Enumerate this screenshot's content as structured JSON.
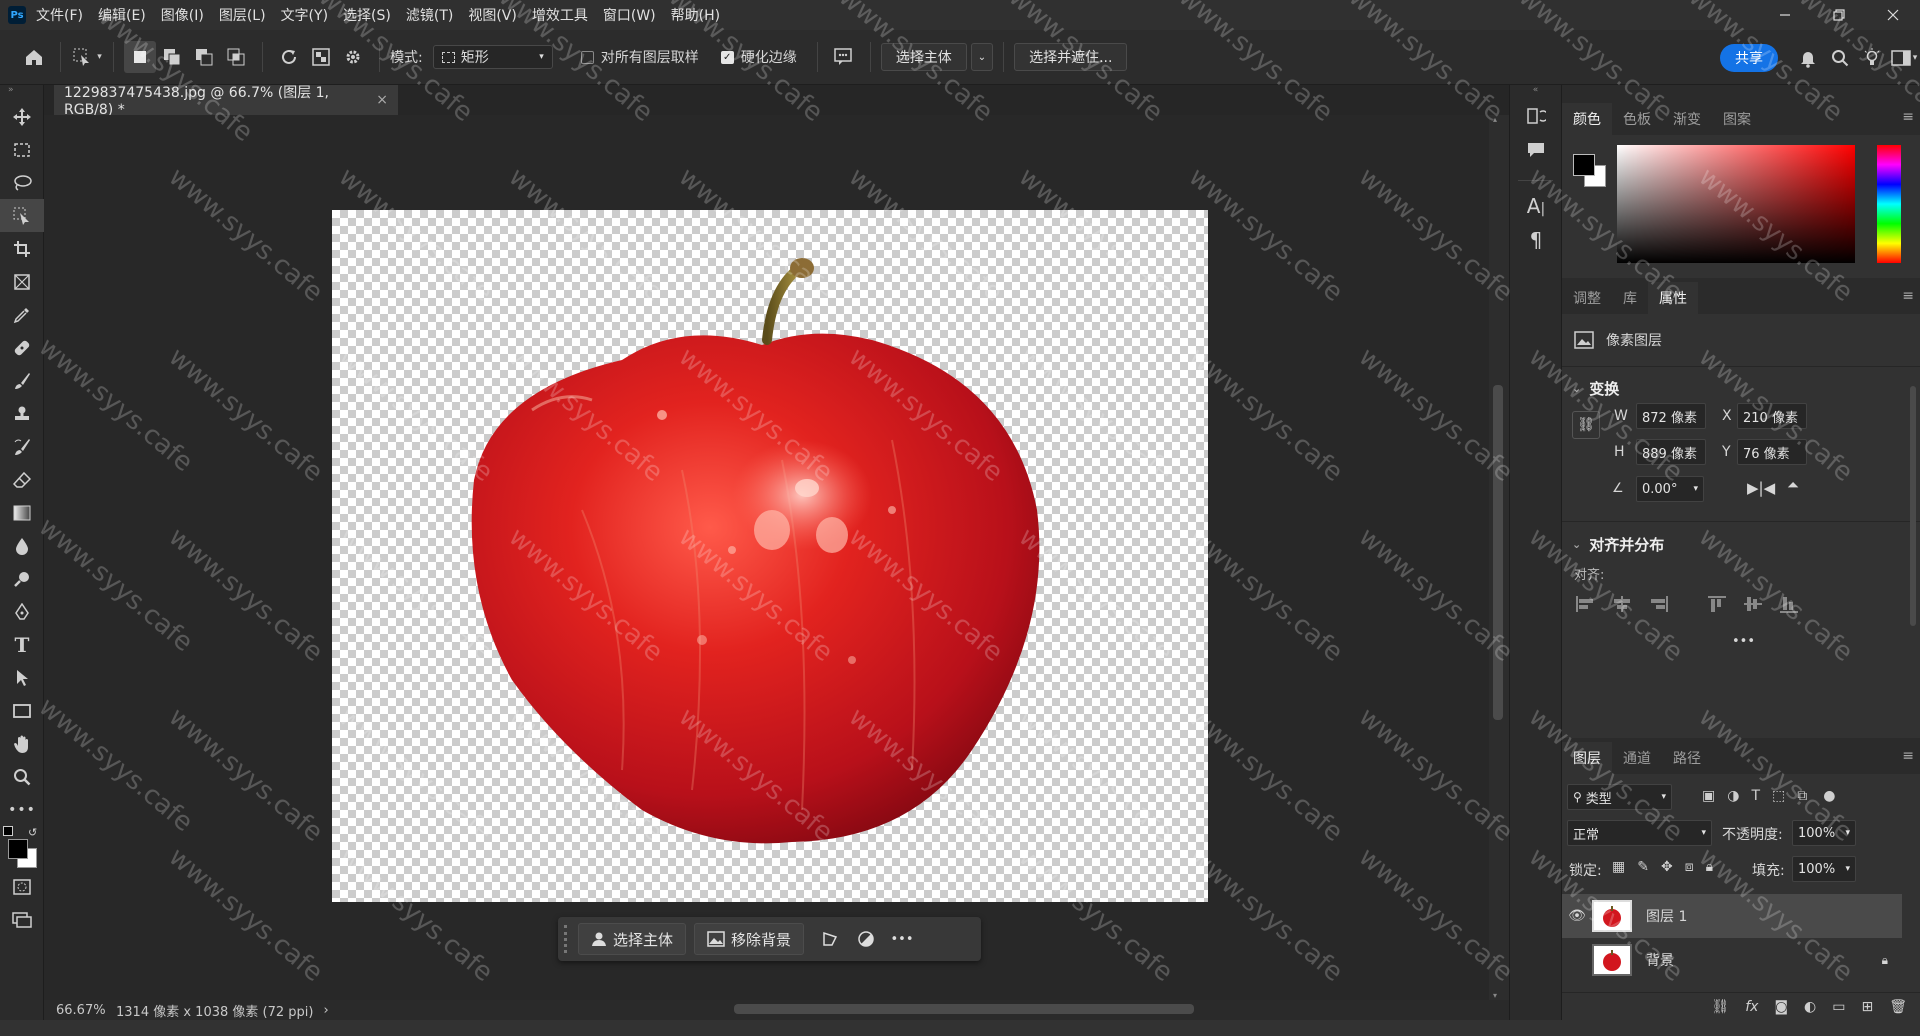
{
  "menubar": {
    "logo": "Ps",
    "items": [
      "文件(F)",
      "编辑(E)",
      "图像(I)",
      "图层(L)",
      "文字(Y)",
      "选择(S)",
      "滤镜(T)",
      "视图(V)",
      "增效工具",
      "窗口(W)",
      "帮助(H)"
    ]
  },
  "options": {
    "mode_label": "模式:",
    "mode_value": "矩形",
    "sample_all_label": "对所有图层取样",
    "sample_all_checked": false,
    "hard_edge_label": "硬化边缘",
    "hard_edge_checked": true,
    "select_subject": "选择主体",
    "select_mask": "选择并遮住...",
    "share": "共享"
  },
  "document": {
    "tab_title": "1229837475438.jpg @ 66.7% (图层 1, RGB/8) *",
    "close": "×"
  },
  "context_bar": {
    "select_subject": "选择主体",
    "remove_bg": "移除背景",
    "more": "•••"
  },
  "status": {
    "zoom": "66.67%",
    "info": "1314 像素 x 1038 像素 (72 ppi)",
    "arrow": "›"
  },
  "color_panel": {
    "tabs": [
      "颜色",
      "色板",
      "渐变",
      "图案"
    ],
    "active": "颜色"
  },
  "properties_panel": {
    "tabs": [
      "调整",
      "库",
      "属性"
    ],
    "active": "属性",
    "layer_type": "像素图层",
    "transform_title": "变换",
    "w_label": "W",
    "w_value": "872 像素",
    "x_label": "X",
    "x_value": "210 像素",
    "h_label": "H",
    "h_value": "889 像素",
    "y_label": "Y",
    "y_value": "76 像素",
    "angle_value": "0.00°",
    "align_title": "对齐并分布",
    "align_label": "对齐:",
    "more": "•••"
  },
  "layers_panel": {
    "tabs": [
      "图层",
      "通道",
      "路径"
    ],
    "active": "图层",
    "filter": "类型",
    "blend_mode": "正常",
    "opacity_label": "不透明度:",
    "opacity_value": "100%",
    "lock_label": "锁定:",
    "fill_label": "填充:",
    "fill_value": "100%",
    "layers": [
      {
        "name": "图层 1",
        "visible": true,
        "selected": true
      },
      {
        "name": "背景",
        "visible": false,
        "locked": true
      }
    ]
  },
  "watermark": "www.syys.cafe",
  "colors": {
    "accent": "#1473e6",
    "apple_red": "#c8161d",
    "stem": "#7a6a2a"
  }
}
